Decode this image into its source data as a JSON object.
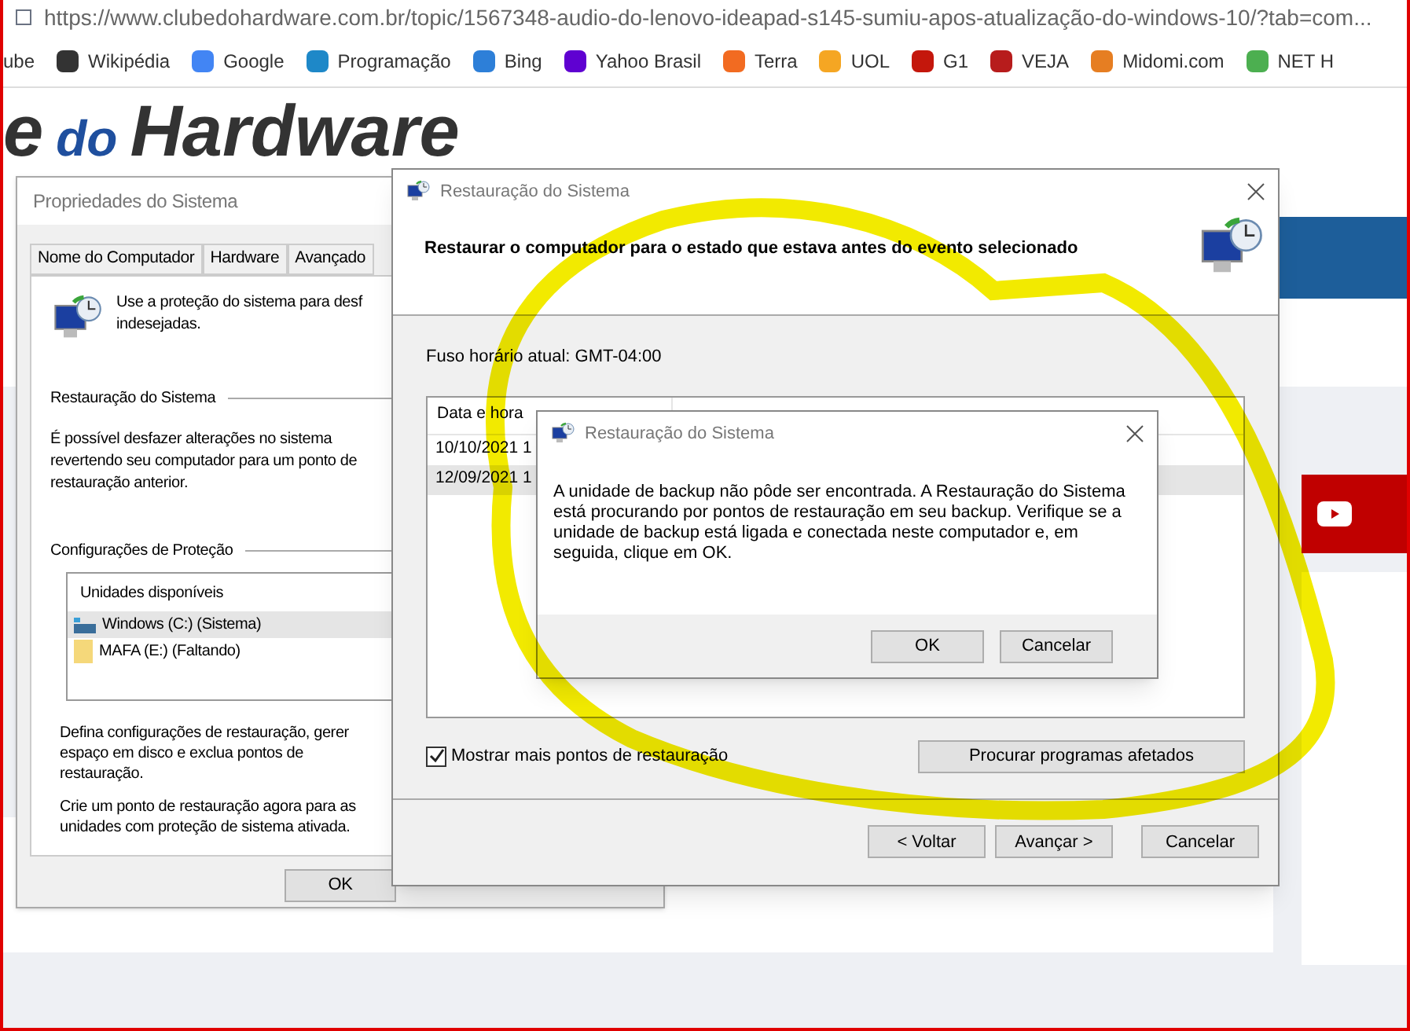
{
  "browser": {
    "url": "https://www.clubedohardware.com.br/topic/1567348-audio-do-lenovo-ideapad-s145-sumiu-apos-atualização-do-windows-10/?tab=com...",
    "bookmarks": [
      "ube",
      "Wikipédia",
      "Google",
      "Programação",
      "Bing",
      "Yahoo Brasil",
      "Terra",
      "UOL",
      "G1",
      "VEJA",
      "Midomi.com",
      "NET H"
    ]
  },
  "site": {
    "logo_main": "e",
    "logo_do": "do",
    "logo_hardware": "Hardware"
  },
  "properties_window": {
    "title": "Propriedades do Sistema",
    "tabs": [
      {
        "label": "Nome do Computador",
        "selected": false
      },
      {
        "label": "Hardware",
        "selected": false
      },
      {
        "label": "Avançado",
        "selected": false
      }
    ],
    "intro": "Use a proteção do sistema para desf\nindesejadas.",
    "restore_heading": "Restauração do Sistema",
    "restore_text": "É possível desfazer alterações no sistema revertendo seu computador para um ponto de restauração anterior.",
    "protection_heading": "Configurações de Proteção",
    "drives_column": "Unidades disponíveis",
    "drives": [
      {
        "label": "Windows (C:) (Sistema)",
        "kind": "system",
        "selected": true
      },
      {
        "label": "MAFA (E:) (Faltando)",
        "kind": "folder",
        "selected": false
      }
    ],
    "configure_text": "Defina configurações de restauração, gerer\nespaço em disco e exclua pontos de\nrestauração.",
    "create_text": "Crie um ponto de restauração agora para as\nunidades com proteção de sistema ativada.",
    "buttons": [
      "OK"
    ]
  },
  "restore_window": {
    "title": "Restauração do Sistema",
    "heading": "Restaurar o computador para o estado que estava antes do evento selecionado",
    "timezone": "Fuso horário atual: GMT-04:00",
    "table": {
      "columns": [
        "Data e hora"
      ],
      "rows": [
        {
          "date": "10/10/2021 1",
          "selected": false
        },
        {
          "date": "12/09/2021 1",
          "selected": true
        }
      ]
    },
    "show_more": {
      "label": "Mostrar mais pontos de restauração",
      "checked": true
    },
    "scan_button": "Procurar programas afetados",
    "buttons": [
      "< Voltar",
      "Avançar >",
      "Cancelar"
    ]
  },
  "alert": {
    "title": "Restauração do Sistema",
    "message": "A unidade de backup não pôde ser encontrada. A Restauração do Sistema está procurando por pontos de restauração em seu backup. Verifique se a unidade de backup está ligada e conectada neste computador e, em seguida, clique em OK.",
    "buttons": [
      "OK",
      "Cancelar"
    ]
  }
}
